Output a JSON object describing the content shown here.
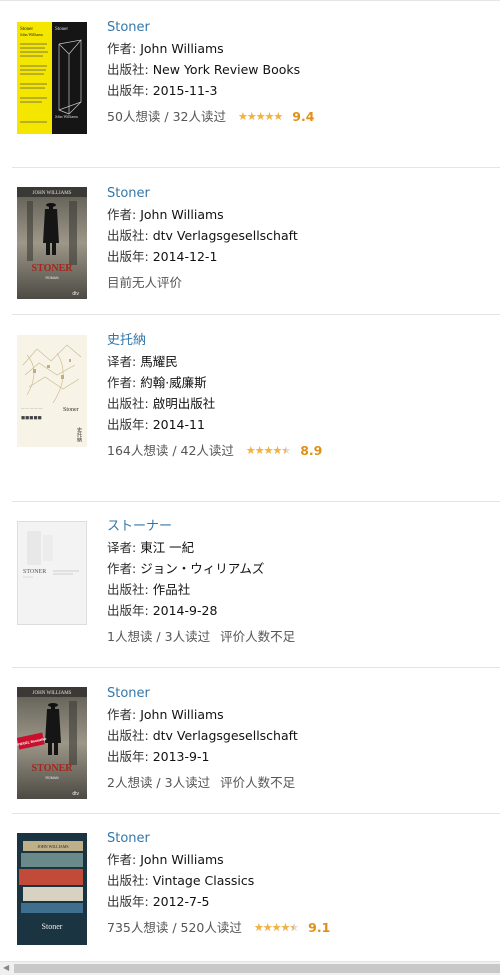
{
  "labels": {
    "author": "作者:",
    "translator": "译者:",
    "publisher": "出版社:",
    "year": "出版年:"
  },
  "books": [
    {
      "title": "Stoner",
      "author": "John Williams",
      "publisher": "New York Review Books",
      "year": "2015-11-3",
      "counts": "50人想读 / 32人读过",
      "stars": 5,
      "score": "9.4",
      "cover_text": [
        "Stoner",
        "John Williams",
        "Stoner",
        "John Williams"
      ]
    },
    {
      "title": "Stoner",
      "author": "John Williams",
      "publisher": "dtv Verlagsgesellschaft",
      "year": "2014-12-1",
      "counts": "目前无人评价",
      "cover_text": [
        "JOHN WILLIAMS",
        "STONER",
        "ROMAN",
        "dtv"
      ]
    },
    {
      "title": "史托納",
      "translator": "馬耀民",
      "author": "約翰·威廉斯",
      "publisher": "啟明出版社",
      "year": "2014-11",
      "counts": "164人想读 / 42人读过",
      "stars": 4.5,
      "score": "8.9",
      "cover_text": [
        "Stoner",
        "史托納"
      ]
    },
    {
      "title": "ストーナー",
      "translator": "東江 一紀",
      "author": "ジョン・ウィリアムズ",
      "publisher": "作品社",
      "year": "2014-9-28",
      "counts": "1人想读 / 3人读过",
      "note": "评价人数不足",
      "cover_text": [
        "STONER"
      ]
    },
    {
      "title": "Stoner",
      "author": "John Williams",
      "publisher": "dtv Verlagsgesellschaft",
      "year": "2013-9-1",
      "counts": "2人想读 / 3人读过",
      "note": "评价人数不足",
      "cover_text": [
        "JOHN WILLIAMS",
        "SPIEGEL Bestseller",
        "STONER",
        "ROMAN",
        "dtv"
      ]
    },
    {
      "title": "Stoner",
      "author": "John Williams",
      "publisher": "Vintage Classics",
      "year": "2012-7-5",
      "counts": "735人想读 / 520人读过",
      "stars": 4.5,
      "score": "9.1",
      "cover_text": [
        "JOHN WILLIAMS",
        "Stoner"
      ]
    }
  ],
  "colors": {
    "link": "#3377aa",
    "star": "#f5b13d",
    "score": "#e09015",
    "cover1_bg": "#f5e600",
    "cover6_bg": "#1b3441"
  }
}
